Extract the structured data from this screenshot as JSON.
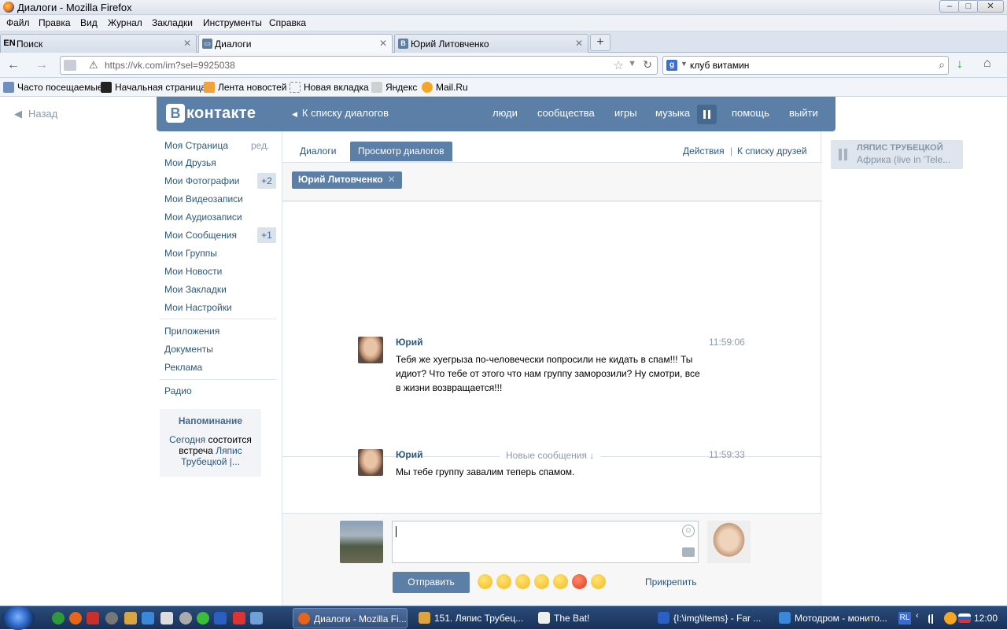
{
  "window": {
    "title": "Диалоги - Mozilla Firefox"
  },
  "menu": [
    "Файл",
    "Правка",
    "Вид",
    "Журнал",
    "Закладки",
    "Инструменты",
    "Справка"
  ],
  "tabs": [
    {
      "label": "Поиск",
      "icon": "EN"
    },
    {
      "label": "Диалоги",
      "icon": "chat-icon"
    },
    {
      "label": "Юрий Литовченко",
      "icon": "vk-icon"
    }
  ],
  "nav": {
    "url": "https://vk.com/im?sel=9925038",
    "search": "клуб витамин"
  },
  "bookmarks": [
    "Часто посещаемые",
    "Начальная страница",
    "Лента новостей",
    "Новая вкладка",
    "Яндекс",
    "Mail.Ru"
  ],
  "page": {
    "back": "Назад",
    "logo": "контакте",
    "logo_b": "В",
    "to_dialogs": "К списку диалогов",
    "topnav": [
      "люди",
      "сообщества",
      "игры",
      "музыка",
      "помощь",
      "выйти"
    ],
    "sidebar": {
      "items": [
        "Моя Страница",
        "Мои Друзья",
        "Мои Фотографии",
        "Мои Видеозаписи",
        "Мои Аудиозаписи",
        "Мои Сообщения",
        "Мои Группы",
        "Мои Новости",
        "Мои Закладки",
        "Мои Настройки"
      ],
      "edit": "ред.",
      "badge_photos": "+2",
      "badge_messages": "+1",
      "extra": [
        "Приложения",
        "Документы",
        "Реклама"
      ],
      "radio": "Радио",
      "reminder": {
        "title": "Напоминание",
        "today": "Сегодня",
        "text": "состоится встреча",
        "link": "Ляпис Трубецкой |..."
      }
    },
    "tabs": {
      "dialogs": "Диалоги",
      "view": "Просмотр диалогов",
      "actions": "Действия",
      "sep": "|",
      "friends": "К списку друзей"
    },
    "chip": "Юрий Литовченко",
    "messages": [
      {
        "name": "Юрий",
        "time": "11:59:06",
        "text": "Тебя же хуегрыза по-человечески попросили не кидать в спам!!! Ты идиот? Что тебе от этого что нам группу заморозили? Ну смотри, все в жизни возвращается!!!"
      },
      {
        "name": "Юрий",
        "time": "11:59:33",
        "text": "Мы тебе группу завалим теперь спамом."
      }
    ],
    "new_messages": "Новые сообщения ↓",
    "send": "Отправить",
    "attach": "Прикрепить",
    "player": {
      "artist": "ЛЯПИС ТРУБЕЦКОЙ",
      "track": "Африка (live in 'Tele..."
    }
  },
  "taskbar": {
    "tasks": [
      "Диалоги - Mozilla Fi...",
      "151. Ляпис Трубец...",
      "The Bat!",
      "{I:\\img\\items} - Far ...",
      "Мотодром - монито..."
    ],
    "lang": "RL",
    "clock": "12:00"
  }
}
